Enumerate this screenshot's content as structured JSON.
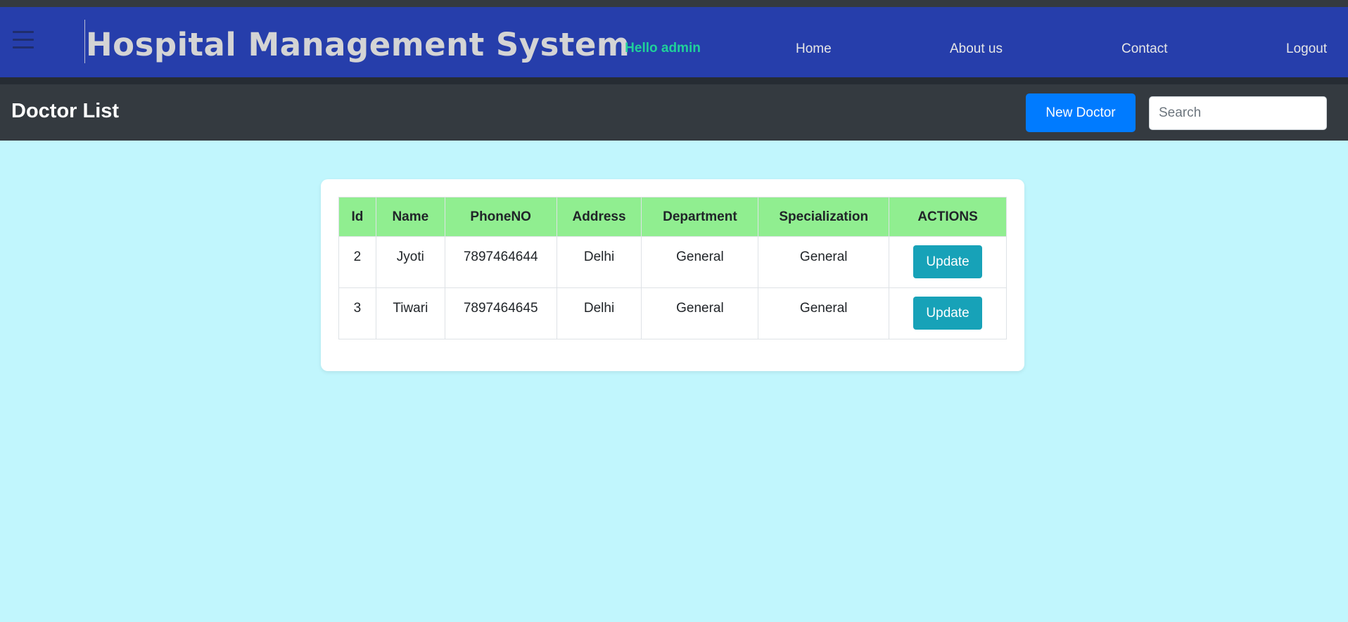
{
  "navbar": {
    "brand": "Hospital Management System",
    "greeting": "Hello admin",
    "links": [
      "Home",
      "About us",
      "Contact",
      "Logout"
    ]
  },
  "toolbar": {
    "title": "Doctor List",
    "new_button": "New Doctor",
    "search_placeholder": "Search"
  },
  "table": {
    "headers": [
      "Id",
      "Name",
      "PhoneNO",
      "Address",
      "Department",
      "Specialization",
      "ACTIONS"
    ],
    "rows": [
      {
        "id": "2",
        "name": "Jyoti",
        "phone": "7897464644",
        "address": "Delhi",
        "department": "General",
        "specialization": "General",
        "action": "Update"
      },
      {
        "id": "3",
        "name": "Tiwari",
        "phone": "7897464645",
        "address": "Delhi",
        "department": "General",
        "specialization": "General",
        "action": "Update"
      }
    ]
  },
  "colors": {
    "navbar": "#263eab",
    "greeting": "#1fd19a",
    "toolbar": "#343a40",
    "page_background": "#c1f6fd",
    "header_row": "#90ee90",
    "primary_button": "#007bff",
    "update_button": "#17a2b8"
  },
  "icons": {
    "menu": "hamburger-menu-icon"
  }
}
